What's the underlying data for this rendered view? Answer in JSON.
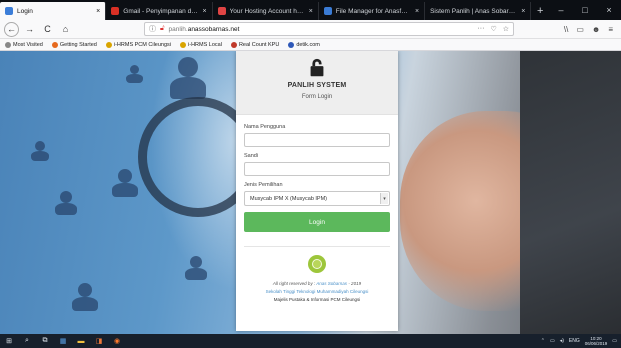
{
  "browser": {
    "tabs": [
      {
        "title": "Login",
        "favicon_color": "#3b7dd8",
        "active": true
      },
      {
        "title": "Gmail - Penyimpanan dan Em",
        "favicon_color": "#d93025",
        "active": false
      },
      {
        "title": "Your Hosting Account has be",
        "favicon_color": "#e04444",
        "active": false
      },
      {
        "title": "File Manager for Anasfabamas",
        "favicon_color": "#3a7bd5",
        "active": false
      },
      {
        "title": "Sistem Panlih | Anas Sobarnas",
        "favicon_color": "#555",
        "active": false
      }
    ],
    "tab_close": "×",
    "new_tab": "+",
    "win_min": "–",
    "win_max": "□",
    "win_close": "×",
    "nav": {
      "back": "←",
      "forward": "→",
      "reload": "C",
      "home": "⌂"
    },
    "url": {
      "prefix": "panlih.",
      "domain": "anassobarnas.net"
    },
    "url_tools": [
      "···",
      "♡",
      "☆"
    ],
    "right_tools": [
      "\\\\",
      "▭",
      "☻",
      "≡"
    ],
    "bookmarks": [
      {
        "label": "Most Visited",
        "color": "#888"
      },
      {
        "label": "Getting Started",
        "color": "#e66a1f"
      },
      {
        "label": "i-HRMS PCM Cileungsi",
        "color": "#d9a400"
      },
      {
        "label": "i-HRMS Local",
        "color": "#d9a400"
      },
      {
        "label": "Real Count KPU",
        "color": "#c0392b"
      },
      {
        "label": "detik.com",
        "color": "#2e58b8"
      }
    ]
  },
  "login": {
    "system_title": "PANLIH SYSTEM",
    "subtitle": "Form Login",
    "username_label": "Nama Pengguna",
    "username_value": "",
    "password_label": "Sandi",
    "password_value": "",
    "election_label": "Jenis Pemilihan",
    "election_selected": "Musycab IPM X (Musycab IPM)",
    "submit_label": "Login",
    "footer": {
      "rights_prefix": "All right reserved by : ",
      "author": "Anas Sobarnas",
      "year": " - 2019",
      "college": "Sekolah Tinggi Teknologi Muhammadiyah Cileungsi",
      "council": "Majelis Pustaka & Informasi PCM Cileungsi"
    }
  },
  "taskbar": {
    "icons": [
      "⊞",
      "⌕",
      "⧉",
      "▦",
      "▬",
      "◨",
      "◉"
    ],
    "tray": [
      "⌃",
      "▭",
      "◂)",
      "ENG"
    ],
    "time": "10:20",
    "date": "06/06/2019"
  },
  "colors": {
    "login_button": "#5cb85c",
    "link": "#4a90c8",
    "taskbar": "#17202c"
  }
}
